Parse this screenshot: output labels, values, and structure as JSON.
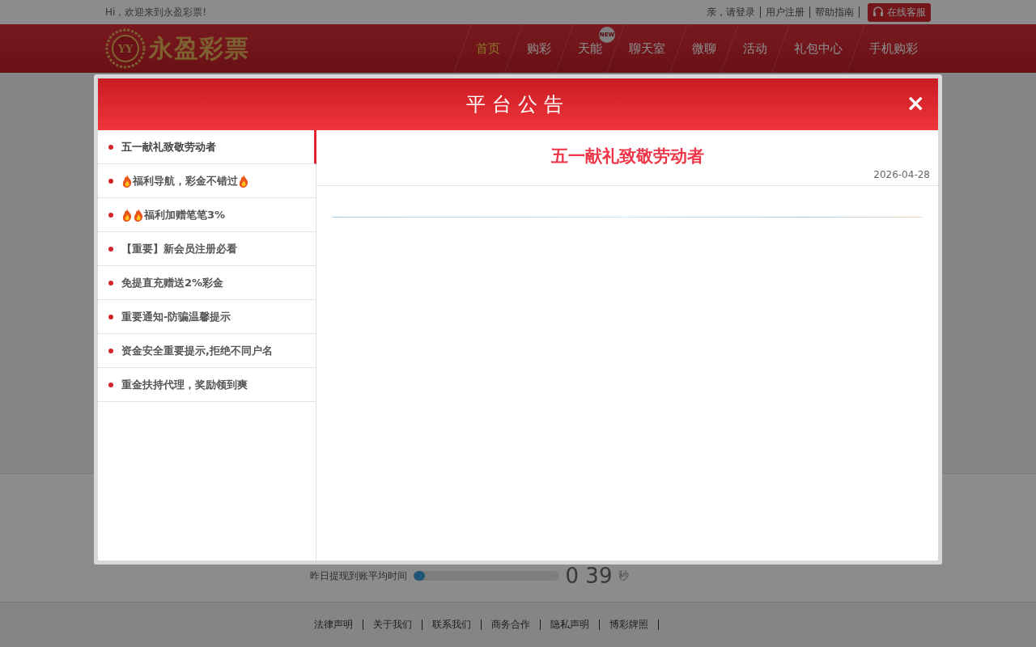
{
  "top_bar": {
    "greeting": "Hi，欢迎来到永盈彩票!",
    "links": [
      "亲，请登录",
      "用户注册",
      "帮助指南"
    ],
    "service_button": "在线客服"
  },
  "header": {
    "logo_monogram": "YY",
    "logo_text": "永盈彩票",
    "nav": [
      {
        "label": "首页",
        "selected": true
      },
      {
        "label": "购彩",
        "selected": false
      },
      {
        "label": "天能",
        "selected": false,
        "badge": "NEW"
      },
      {
        "label": "聊天室",
        "selected": false
      },
      {
        "label": "微聊",
        "selected": false
      },
      {
        "label": "活动",
        "selected": false
      },
      {
        "label": "礼包中心",
        "selected": false
      },
      {
        "label": "手机购彩",
        "selected": false
      }
    ]
  },
  "stats": {
    "label": "昨日提现到账平均时间",
    "level": 0.08,
    "value": "0 39",
    "unit": "秒"
  },
  "footer": {
    "links": [
      "法律声明",
      "关于我们",
      "联系我们",
      "商务合作",
      "隐私声明",
      "博彩牌照"
    ]
  },
  "modal": {
    "title": "平台公告",
    "close": "×",
    "items": [
      {
        "title": "五一献礼致敬劳动者",
        "selected": true,
        "kind": "plain"
      },
      {
        "title": "福利导航，彩金不错过",
        "selected": false,
        "kind": "flame-both"
      },
      {
        "title": "福利加赠笔笔3%",
        "selected": false,
        "kind": "flame-double"
      },
      {
        "title": "【重要】新会员注册必看",
        "selected": false,
        "kind": "plain"
      },
      {
        "title": "免提直充赠送2%彩金",
        "selected": false,
        "kind": "plain"
      },
      {
        "title": "重要通知-防骗温馨提示",
        "selected": false,
        "kind": "plain"
      },
      {
        "title": "资金安全重要提示,拒绝不同户名",
        "selected": false,
        "kind": "plain"
      },
      {
        "title": "重金扶持代理，奖励领到爽",
        "selected": false,
        "kind": "plain"
      }
    ],
    "article": {
      "title": "五一献礼致敬劳动者",
      "date": "2026-04-28"
    }
  }
}
